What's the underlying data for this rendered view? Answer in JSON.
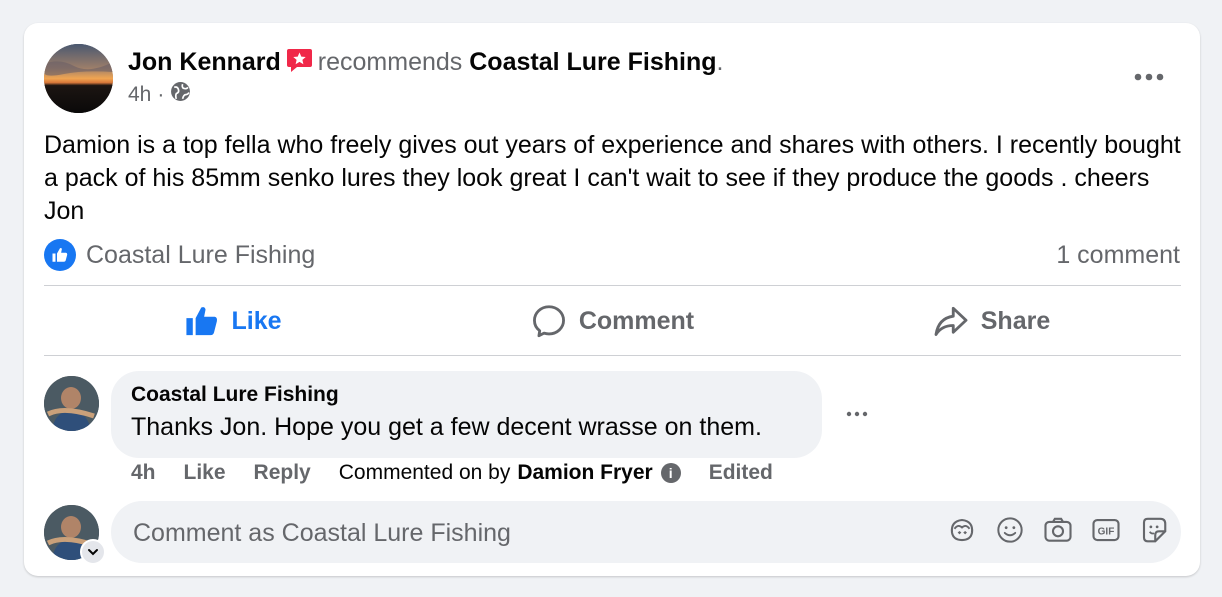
{
  "post": {
    "author": "Jon Kennard",
    "action_text": "recommends",
    "page_name": "Coastal Lure Fishing",
    "period": ".",
    "time": "4h",
    "meta_separator": "·",
    "privacy_icon": "globe-icon",
    "body": "Damion is a top fella who freely gives out years of experience and shares with others. I recently bought a pack of his 85mm senko lures they look great I can't wait to see if they produce the goods . cheers Jon",
    "reaction_label": "Coastal Lure Fishing",
    "comment_count": "1 comment"
  },
  "actions": {
    "like": "Like",
    "comment": "Comment",
    "share": "Share"
  },
  "comment": {
    "author": "Coastal Lure Fishing",
    "text": "Thanks Jon. Hope you get a few decent wrasse on them.",
    "time": "4h",
    "like": "Like",
    "reply": "Reply",
    "commented_on_by": "Commented on by",
    "by_name": "Damion Fryer",
    "edited": "Edited"
  },
  "composer": {
    "placeholder": "Comment as Coastal Lure Fishing"
  },
  "colors": {
    "accent": "#1877f2",
    "secondary_text": "#65676b",
    "badge": "#f02849"
  }
}
